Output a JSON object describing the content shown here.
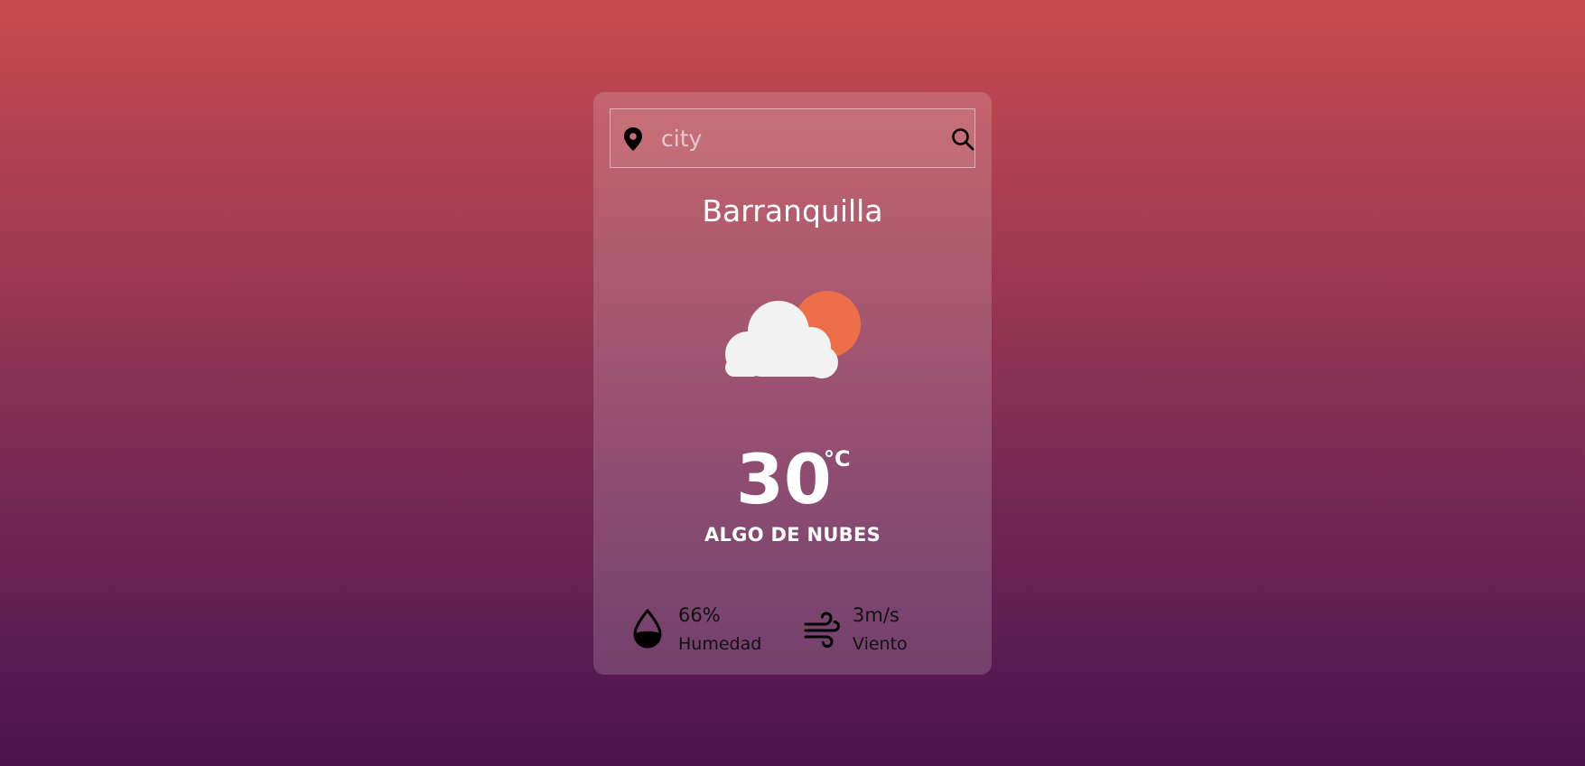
{
  "search": {
    "placeholder": "city",
    "value": "",
    "location_icon": "map-pin-icon",
    "search_icon": "magnifier-icon"
  },
  "weather": {
    "city": "Barranquilla",
    "icon": "partly-cloudy-day-icon",
    "temperature": "30",
    "unit": "°C",
    "description": "ALGO DE NUBES"
  },
  "stats": {
    "humidity": {
      "value": "66%",
      "label": "Humedad",
      "icon": "water-drop-icon"
    },
    "wind": {
      "value": "3m/s",
      "label": "Viento",
      "icon": "wind-icon"
    }
  },
  "colors": {
    "background_top": "#c84b4e",
    "background_bottom": "#4c124a",
    "sun": "#ec6f48",
    "cloud": "#f2f2f2",
    "text": "#ffffff",
    "stat_text": "#111111"
  }
}
